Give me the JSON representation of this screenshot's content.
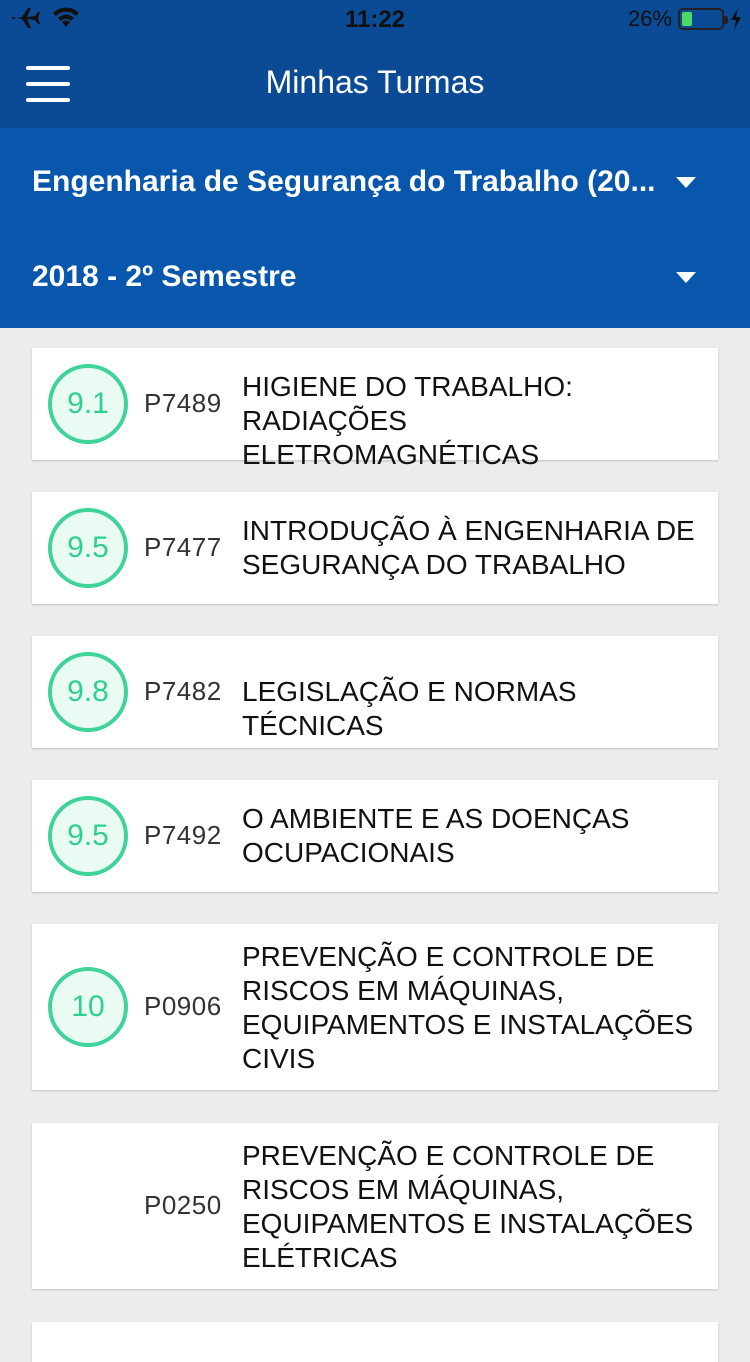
{
  "status": {
    "time": "11:22",
    "battery": "26%",
    "battery_level_percent": 26
  },
  "header": {
    "title": "Minhas Turmas"
  },
  "filters": {
    "course": "Engenharia de Segurança do Trabalho (20...",
    "semester": "2018 - 2º Semestre"
  },
  "courses": [
    {
      "grade": "9.1",
      "code": "P7489",
      "name": "HIGIENE DO TRABALHO: RADIAÇÕES ELETROMAGNÉTICAS"
    },
    {
      "grade": "9.5",
      "code": "P7477",
      "name": "INTRODUÇÃO À ENGENHARIA DE SEGURANÇA DO TRABALHO"
    },
    {
      "grade": "9.8",
      "code": "P7482",
      "name": "LEGISLAÇÃO E NORMAS TÉCNICAS"
    },
    {
      "grade": "9.5",
      "code": "P7492",
      "name": "O AMBIENTE E AS DOENÇAS OCUPACIONAIS"
    },
    {
      "grade": "10",
      "code": "P0906",
      "name": "PREVENÇÃO E CONTROLE DE RISCOS EM MÁQUINAS, EQUIPAMENTOS E INSTALAÇÕES CIVIS"
    },
    {
      "grade": "",
      "code": "P0250",
      "name": "PREVENÇÃO E CONTROLE DE RISCOS EM MÁQUINAS, EQUIPAMENTOS E INSTALAÇÕES ELÉTRICAS"
    }
  ],
  "colors": {
    "header": "#0b4a95",
    "filters": "#0957ac",
    "grade_ring": "#3fd39a",
    "grade_bg": "#e9fbf3"
  }
}
